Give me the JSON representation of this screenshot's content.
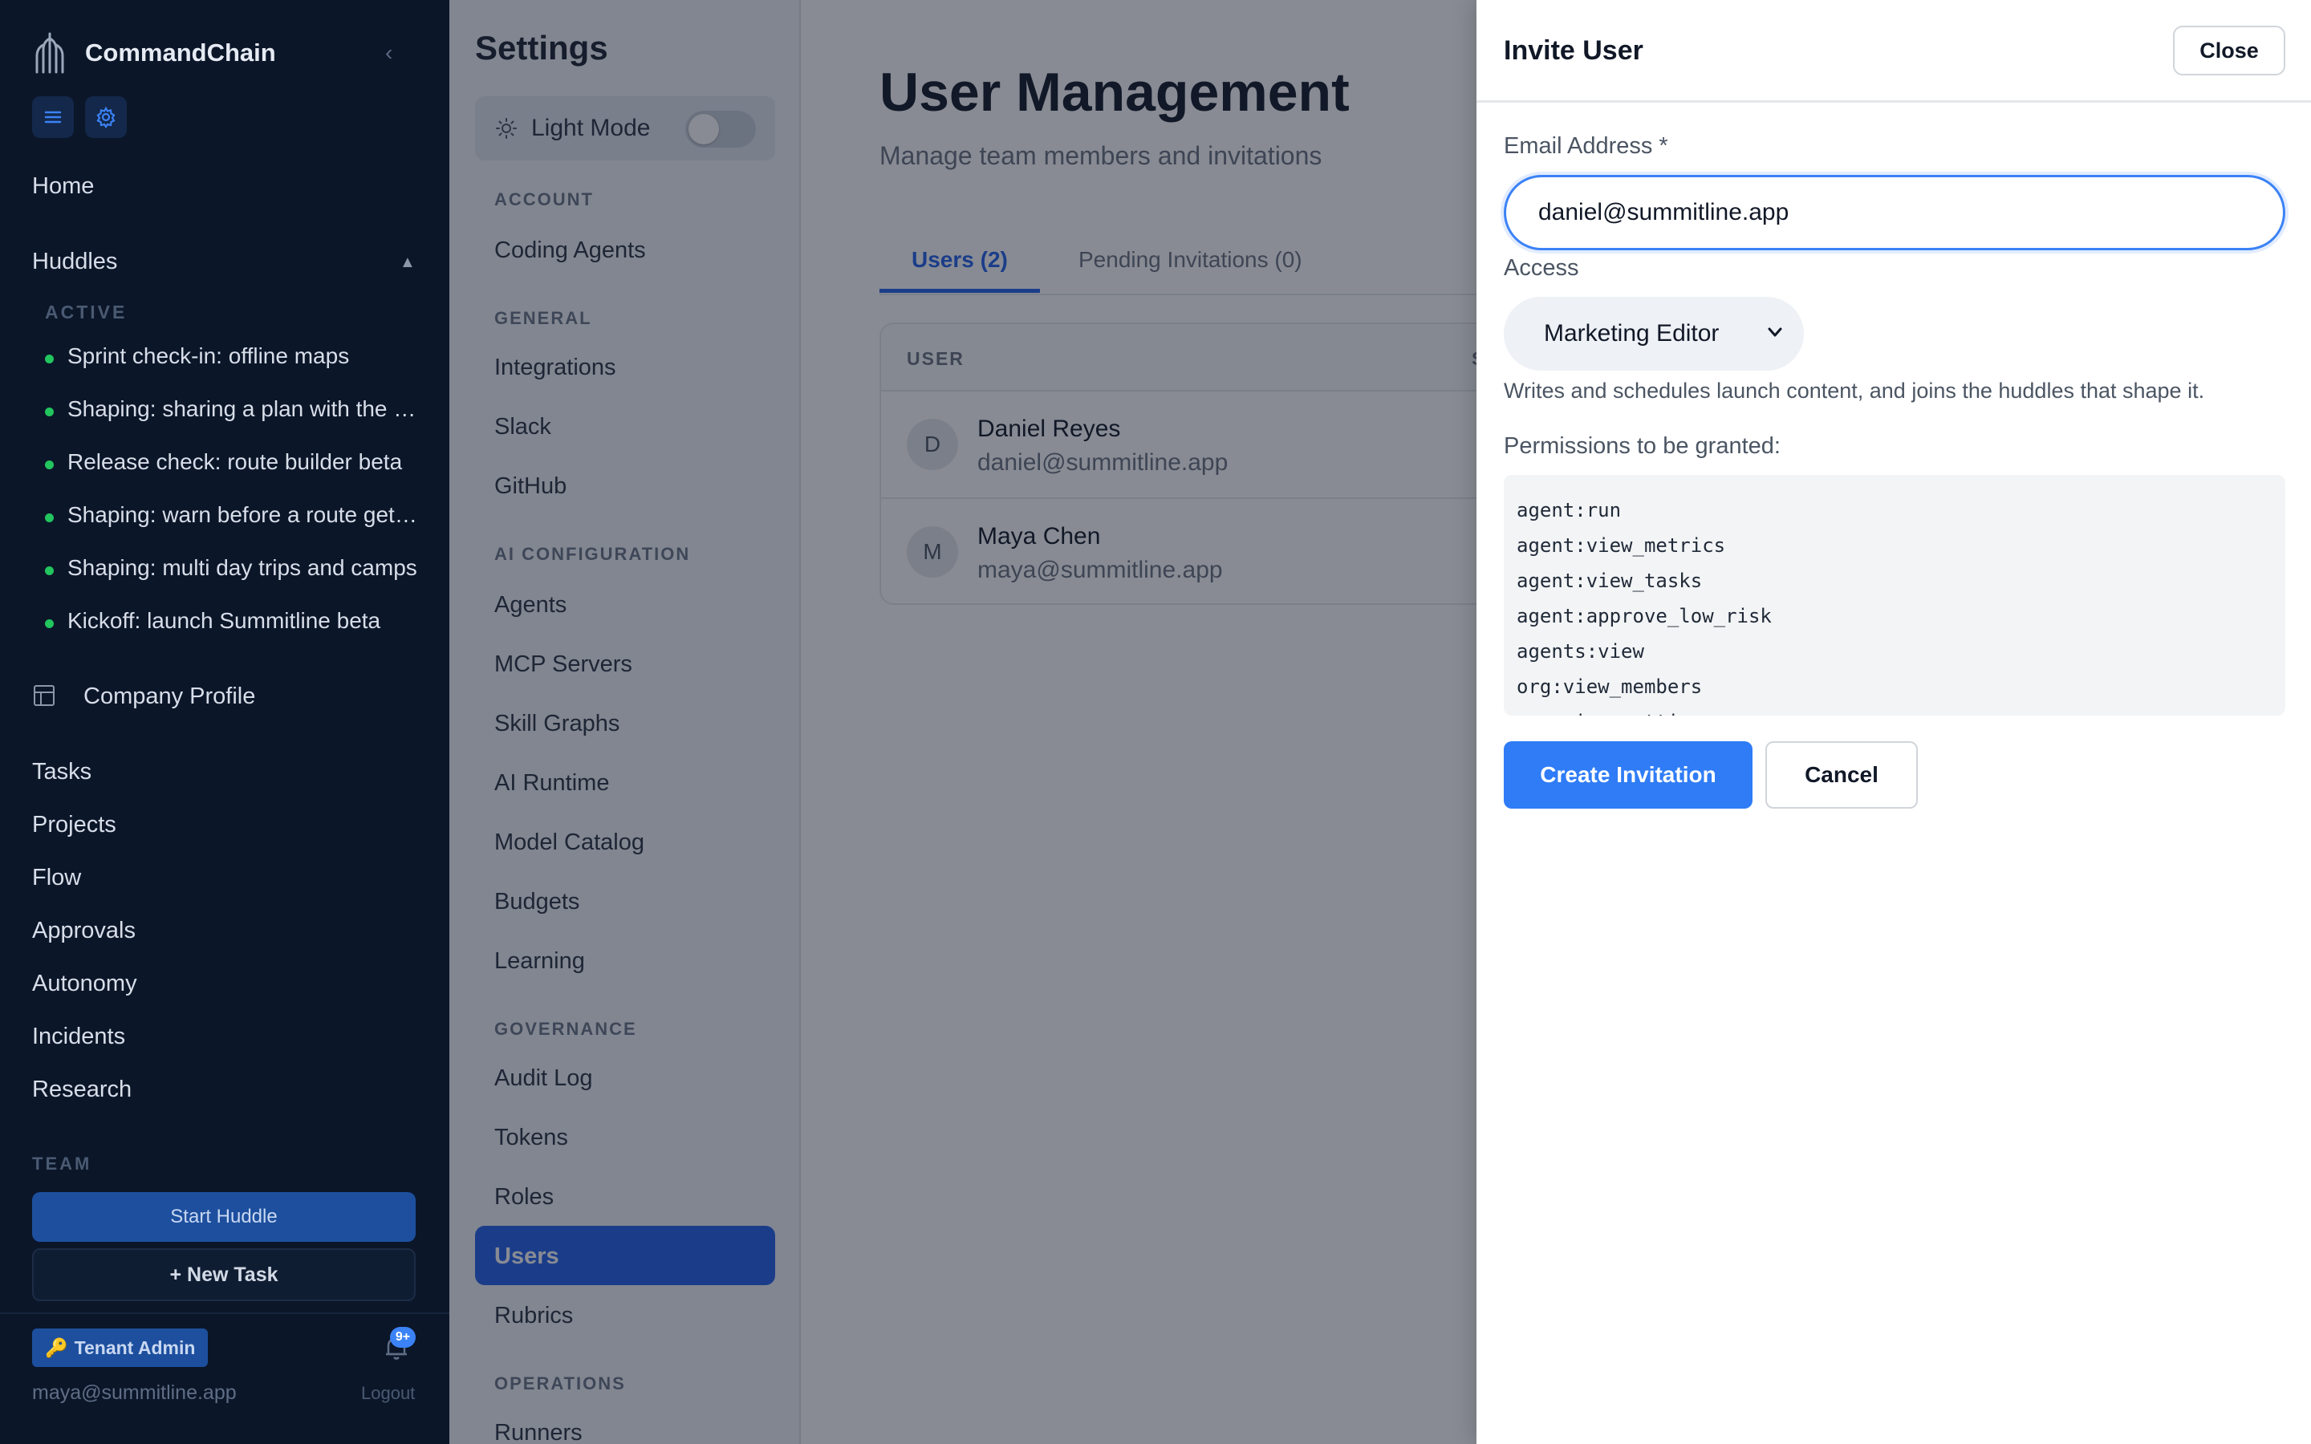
{
  "app": {
    "name": "CommandChain"
  },
  "sidebar": {
    "home": "Home",
    "huddles_label": "Huddles",
    "active_label": "ACTIVE",
    "huddles": [
      "Sprint check-in: offline maps",
      "Shaping: sharing a plan with the group",
      "Release check: route builder beta",
      "Shaping: warn before a route gets risky",
      "Shaping: multi day trips and camps",
      "Kickoff: launch Summitline beta"
    ],
    "company_profile": "Company Profile",
    "nav": [
      "Tasks",
      "Projects",
      "Flow",
      "Approvals",
      "Autonomy",
      "Incidents",
      "Research"
    ],
    "team_label": "TEAM",
    "start_huddle": "Start Huddle",
    "new_task": "+ New Task",
    "role_badge": "Tenant Admin",
    "notification_count": "9+",
    "user_email": "maya@summitline.app",
    "logout": "Logout"
  },
  "settings": {
    "title": "Settings",
    "mode_label": "Light Mode",
    "sections": {
      "account": "ACCOUNT",
      "general": "GENERAL",
      "ai": "AI CONFIGURATION",
      "governance": "GOVERNANCE",
      "operations": "OPERATIONS"
    },
    "items": {
      "coding_agents": "Coding Agents",
      "integrations": "Integrations",
      "slack": "Slack",
      "github": "GitHub",
      "agents": "Agents",
      "mcp": "MCP Servers",
      "skill_graphs": "Skill Graphs",
      "ai_runtime": "AI Runtime",
      "model_catalog": "Model Catalog",
      "budgets": "Budgets",
      "learning": "Learning",
      "audit_log": "Audit Log",
      "tokens": "Tokens",
      "roles": "Roles",
      "users": "Users",
      "rubrics": "Rubrics",
      "runners": "Runners"
    }
  },
  "main": {
    "title": "User Management",
    "subtitle": "Manage team members and invitations",
    "tabs": [
      "Users (2)",
      "Pending Invitations (0)"
    ],
    "table": {
      "col_user": "USER",
      "col_s": "S",
      "rows": [
        {
          "initial": "D",
          "name": "Daniel Reyes",
          "email": "daniel@summitline.app"
        },
        {
          "initial": "M",
          "name": "Maya Chen",
          "email": "maya@summitline.app"
        }
      ]
    }
  },
  "invite": {
    "title": "Invite User",
    "close": "Close",
    "email_label": "Email Address *",
    "email_value": "daniel@summitline.app",
    "access_label": "Access",
    "access_value": "Marketing Editor",
    "access_help": "Writes and schedules launch content, and joins the huddles that shape it.",
    "permissions_label": "Permissions to be granted:",
    "permissions": [
      "agent:run",
      "agent:view_metrics",
      "agent:view_tasks",
      "agent:approve_low_risk",
      "agents:view",
      "org:view_members",
      "org:view_settings"
    ],
    "create": "Create Invitation",
    "cancel": "Cancel"
  },
  "colors": {
    "sidebar_bg": "#0b1629",
    "accent": "#2563eb",
    "primary_button": "#2f7cf6",
    "active_dot": "#22c55e"
  }
}
